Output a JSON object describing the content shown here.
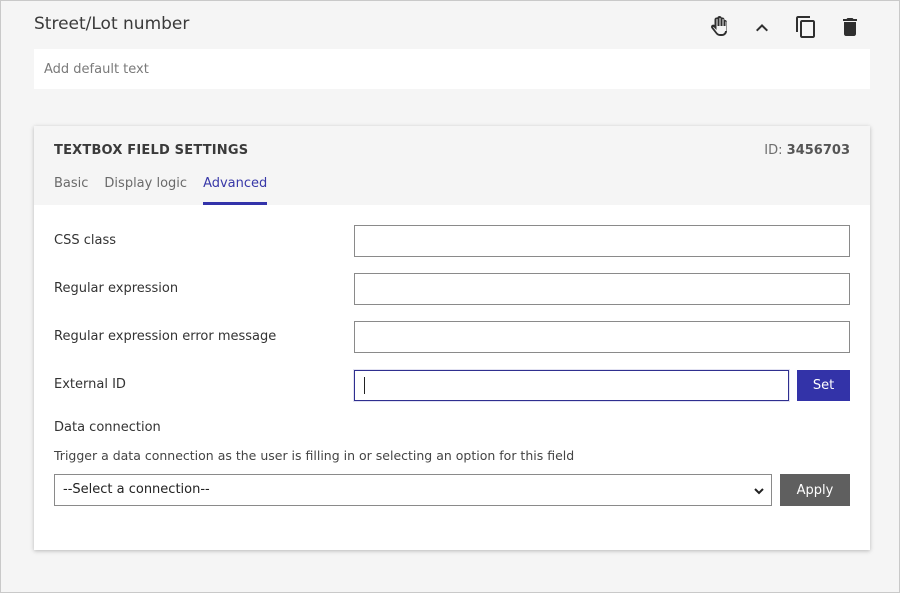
{
  "field": {
    "title": "Street/Lot number",
    "default_placeholder": "Add default text",
    "toolbar": [
      {
        "name": "drag-hand-icon"
      },
      {
        "name": "collapse-chevron-up-icon"
      },
      {
        "name": "duplicate-copy-icon"
      },
      {
        "name": "delete-trash-icon"
      }
    ]
  },
  "settings": {
    "title": "TEXTBOX FIELD SETTINGS",
    "id_label": "ID:",
    "id_value": "3456703",
    "tabs": [
      {
        "label": "Basic",
        "active": false
      },
      {
        "label": "Display logic",
        "active": false
      },
      {
        "label": "Advanced",
        "active": true
      }
    ],
    "css_class": {
      "label": "CSS class",
      "value": ""
    },
    "regex": {
      "label": "Regular expression",
      "value": ""
    },
    "regex_error": {
      "label": "Regular expression error message",
      "value": ""
    },
    "external_id": {
      "label": "External ID",
      "value": "",
      "button": "Set"
    },
    "data_connection": {
      "heading": "Data connection",
      "description": "Trigger a data connection as the user is filling in or selecting an option for this field",
      "selected": "--Select a connection--",
      "button": "Apply"
    }
  },
  "colors": {
    "accent": "#3333a8",
    "apply_button": "#5f5f5f",
    "panel_background": "#f5f5f5"
  }
}
